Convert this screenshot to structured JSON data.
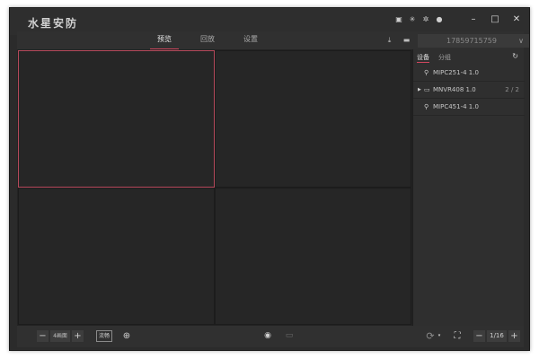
{
  "app": {
    "title": "水星安防"
  },
  "nav": {
    "tabs": [
      {
        "label": "预览",
        "active": true
      },
      {
        "label": "回放",
        "active": false
      },
      {
        "label": "设置",
        "active": false
      }
    ],
    "account": "17859715759"
  },
  "panel": {
    "tabs": [
      {
        "label": "设备",
        "active": true
      },
      {
        "label": "分组",
        "active": false
      }
    ],
    "devices": [
      {
        "name": "MIPC251-4 1.0",
        "icon": "camera-icon",
        "count": ""
      },
      {
        "name": "MNVR408 1.0",
        "icon": "nvr-icon",
        "count": "2 / 2",
        "expandable": true
      },
      {
        "name": "MIPC451-4 1.0",
        "icon": "camera-icon",
        "count": ""
      }
    ]
  },
  "toolbar": {
    "layout_label": "4画面",
    "stream_label": "流畅",
    "page": "1/16"
  },
  "colors": {
    "accent": "#d0475e",
    "background": "#2b2b2b"
  }
}
